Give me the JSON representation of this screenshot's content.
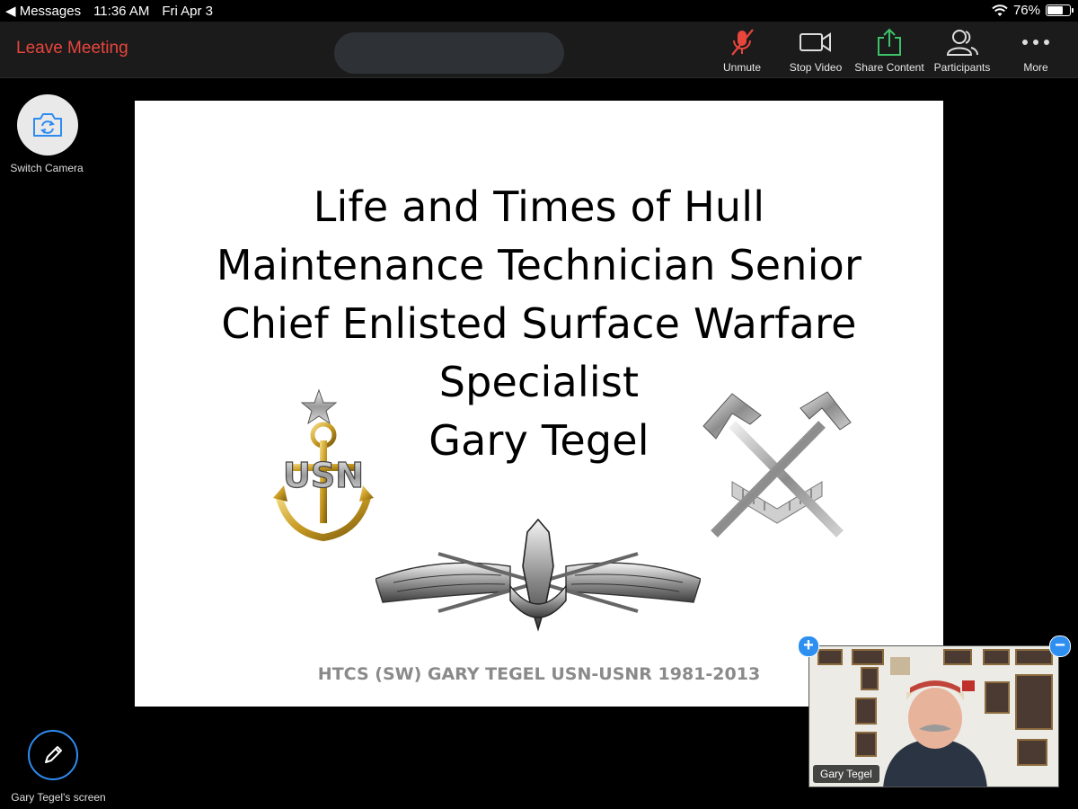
{
  "status_bar": {
    "back_app": "Messages",
    "time": "11:36 AM",
    "date": "Fri Apr 3",
    "battery": "76%",
    "battery_level": 0.76
  },
  "toolbar": {
    "leave_label": "Leave Meeting",
    "buttons": [
      {
        "label": "Unmute",
        "icon": "microphone-muted-icon"
      },
      {
        "label": "Stop Video",
        "icon": "video-camera-icon"
      },
      {
        "label": "Share Content",
        "icon": "share-upload-icon"
      },
      {
        "label": "Participants",
        "icon": "participants-icon"
      },
      {
        "label": "More",
        "icon": "more-dots-icon"
      }
    ],
    "colors": {
      "leave": "#e8453c",
      "mic_muted": "#e8453c",
      "share": "#3cc36a"
    }
  },
  "left_controls": {
    "switch_camera_label": "Switch Camera",
    "screen_label": "Gary Tegel's screen"
  },
  "slide": {
    "title_lines": [
      "Life and Times of Hull",
      "Maintenance Technician Senior",
      "Chief Enlisted Surface Warfare",
      "Specialist",
      "Gary Tegel"
    ],
    "emblem_text": "USN",
    "footer": "HTCS (SW) GARY TEGEL USN-USNR 1981-2013"
  },
  "participant": {
    "name": "Gary Tegel"
  }
}
